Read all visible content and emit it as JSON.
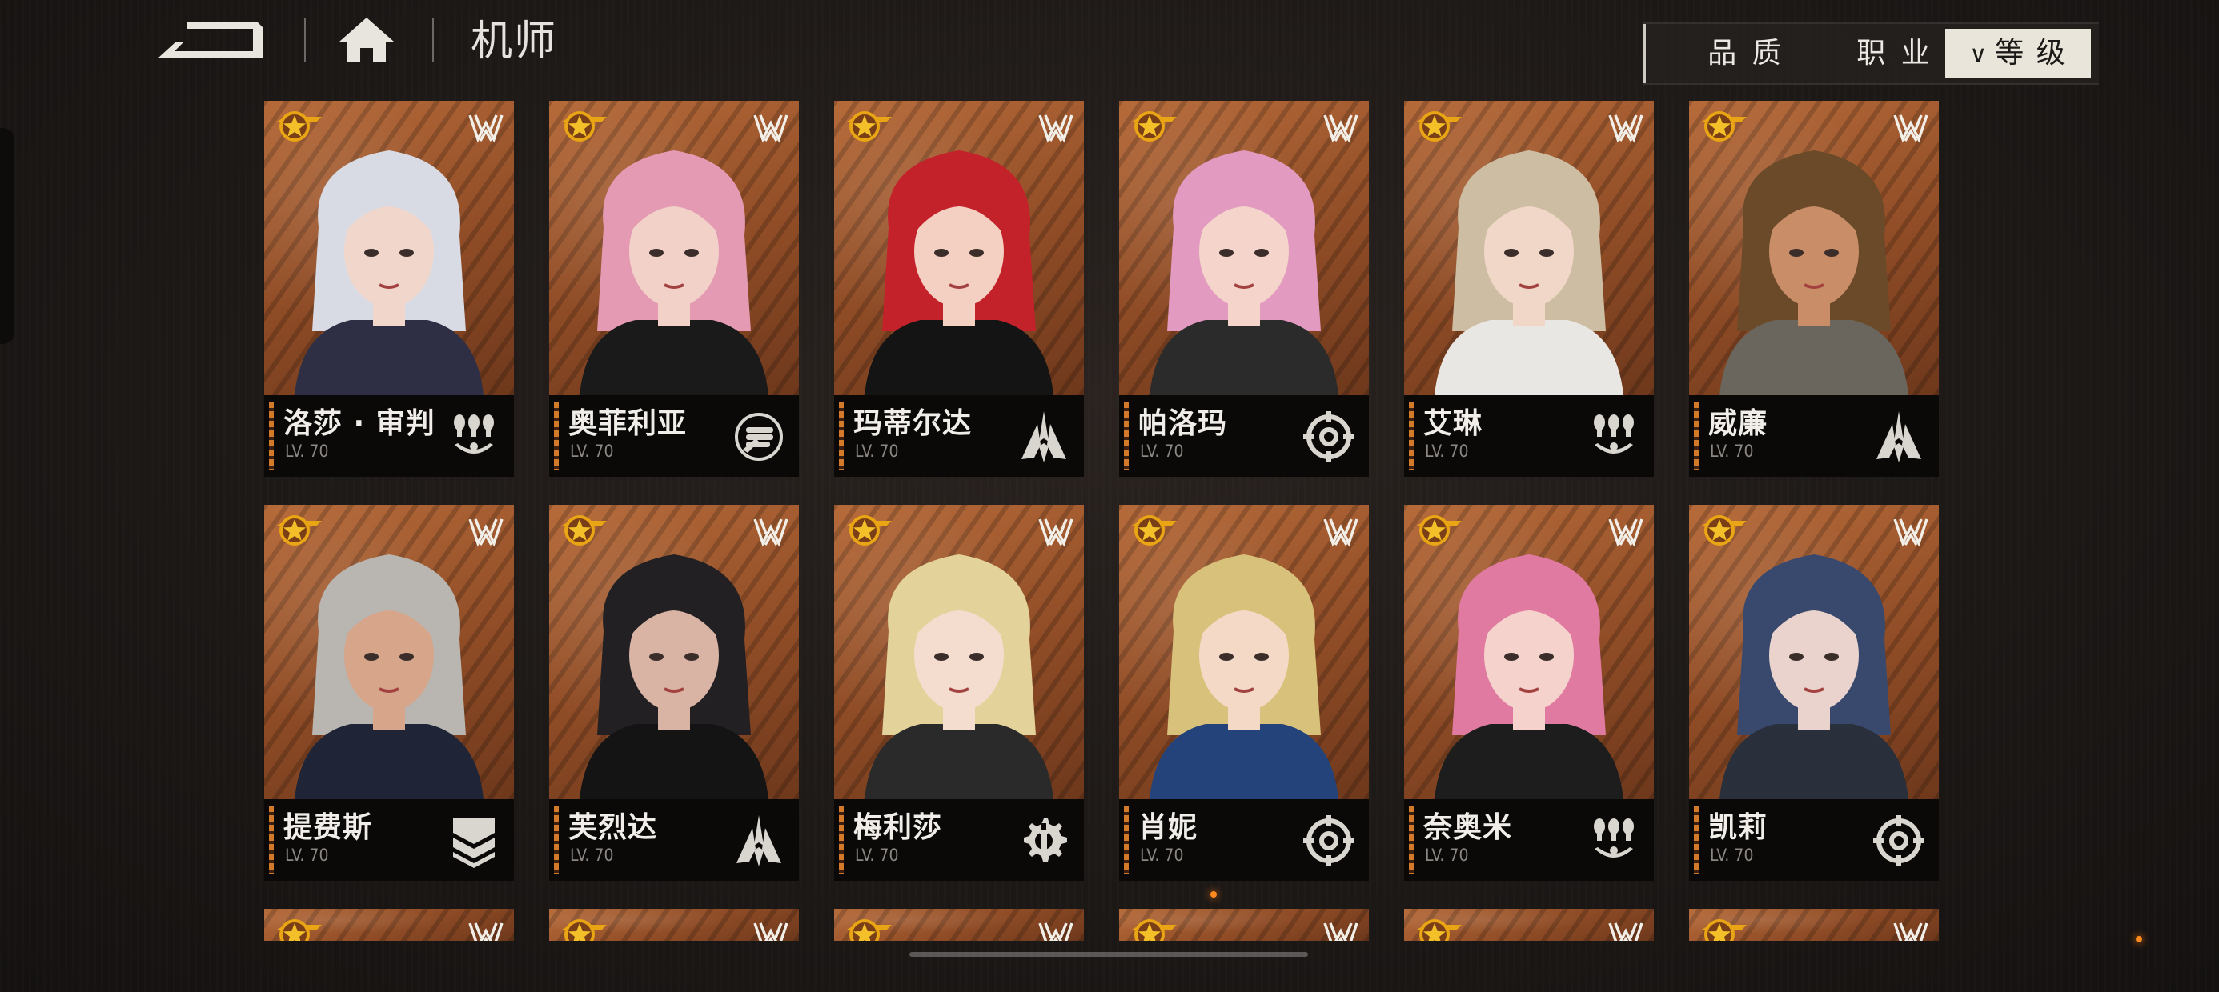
{
  "header": {
    "title": "机师",
    "back_icon": "back-arrow-icon",
    "home_icon": "home-icon"
  },
  "filters": {
    "quality": "品 质",
    "class": "职 业",
    "level": "等 级",
    "active": "level"
  },
  "colors": {
    "card_bg": "#a35a2e",
    "accent_orange": "#d37a2a",
    "star_gold": "#e9a514",
    "active_filter_bg": "#e9e5da"
  },
  "pilots": [
    {
      "name": "洛莎 · 审判",
      "level": "LV. 70",
      "class_icon": "bombs-icon",
      "faction_icon": "wings-emblem-icon"
    },
    {
      "name": "奥菲利亚",
      "level": "LV. 70",
      "class_icon": "shield-fist-icon",
      "faction_icon": "wings-emblem-icon"
    },
    {
      "name": "玛蒂尔达",
      "level": "LV. 70",
      "class_icon": "spire-icon",
      "faction_icon": "wings-emblem-icon"
    },
    {
      "name": "帕洛玛",
      "level": "LV. 70",
      "class_icon": "crosshair-icon",
      "faction_icon": "wings-emblem-icon"
    },
    {
      "name": "艾琳",
      "level": "LV. 70",
      "class_icon": "bombs-icon",
      "faction_icon": "wings-emblem-icon"
    },
    {
      "name": "威廉",
      "level": "LV. 70",
      "class_icon": "spire-icon",
      "faction_icon": "wings-emblem-icon"
    },
    {
      "name": "提费斯",
      "level": "LV. 70",
      "class_icon": "chevron-shield-icon",
      "faction_icon": "wings-emblem-icon"
    },
    {
      "name": "芙烈达",
      "level": "LV. 70",
      "class_icon": "spire-icon",
      "faction_icon": "wings-emblem-icon"
    },
    {
      "name": "梅利莎",
      "level": "LV. 70",
      "class_icon": "gear-wrench-icon",
      "faction_icon": "wings-emblem-icon"
    },
    {
      "name": "肖妮",
      "level": "LV. 70",
      "class_icon": "crosshair-icon",
      "faction_icon": "wings-emblem-icon"
    },
    {
      "name": "奈奥米",
      "level": "LV. 70",
      "class_icon": "bombs-icon",
      "faction_icon": "wings-emblem-icon"
    },
    {
      "name": "凯莉",
      "level": "LV. 70",
      "class_icon": "crosshair-icon",
      "faction_icon": "wings-emblem-icon"
    }
  ],
  "partial_row_count": 6
}
